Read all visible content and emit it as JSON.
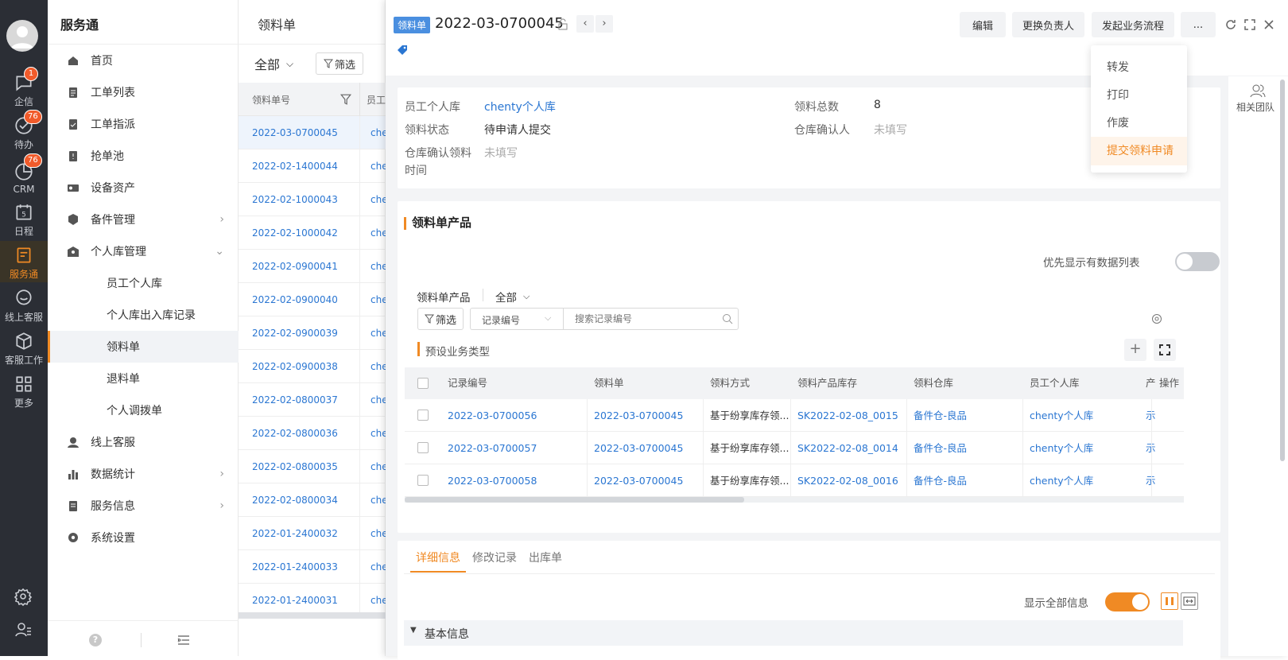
{
  "rail": {
    "items": [
      {
        "label": "企信",
        "badge": "1"
      },
      {
        "label": "待办",
        "badge": "76"
      },
      {
        "label": "CRM",
        "badge": "76"
      },
      {
        "label": "日程",
        "badge": ""
      },
      {
        "label": "服务通",
        "badge": ""
      },
      {
        "label": "线上客服",
        "badge": ""
      },
      {
        "label": "客服工作",
        "badge": ""
      },
      {
        "label": "更多",
        "badge": ""
      }
    ],
    "calendar_day": "5"
  },
  "menu": {
    "title": "服务通",
    "items": [
      {
        "label": "首页"
      },
      {
        "label": "工单列表"
      },
      {
        "label": "工单指派"
      },
      {
        "label": "抢单池"
      },
      {
        "label": "设备资产"
      },
      {
        "label": "备件管理"
      },
      {
        "label": "个人库管理"
      },
      {
        "label": "员工个人库"
      },
      {
        "label": "个人库出入库记录"
      },
      {
        "label": "领料单"
      },
      {
        "label": "退料单"
      },
      {
        "label": "个人调拨单"
      },
      {
        "label": "线上客服"
      },
      {
        "label": "数据统计"
      },
      {
        "label": "服务信息"
      },
      {
        "label": "系统设置"
      }
    ]
  },
  "list": {
    "title": "领料单",
    "scope": "全部",
    "filter": "筛选",
    "col_header": "领料单号",
    "col2_header": "员工",
    "row_suffix": "che",
    "rows": [
      "2022-03-0700045",
      "2022-02-1400044",
      "2022-02-1000043",
      "2022-02-1000042",
      "2022-02-0900041",
      "2022-02-0900040",
      "2022-02-0900039",
      "2022-02-0900038",
      "2022-02-0800037",
      "2022-02-0800036",
      "2022-02-0800035",
      "2022-02-0800034",
      "2022-01-2400032",
      "2022-01-2400033",
      "2022-01-2400031"
    ]
  },
  "detail": {
    "tag": "领料单",
    "number": "2022-03-0700045",
    "buttons": {
      "edit": "编辑",
      "change_owner": "更换负责人",
      "start_flow": "发起业务流程",
      "more": "..."
    },
    "dropdown": [
      "转发",
      "打印",
      "作废",
      "提交领料申请"
    ],
    "side_team": "相关团队",
    "fields": {
      "warehouse_label": "员工个人库",
      "warehouse_value": "chenty个人库",
      "total_label": "领料总数",
      "total_value": "8",
      "status_label": "领料状态",
      "status_value": "待申请人提交",
      "confirmer_label": "仓库确认人",
      "confirmer_value": "未填写",
      "confirm_time_label_1": "仓库确认领料",
      "confirm_time_label_2": "时间",
      "confirm_time_value": "未填写"
    },
    "products": {
      "title": "领料单产品",
      "toggle_label": "优先显示有数据列表",
      "sub_title": "领料单产品",
      "scope": "全部",
      "filter": "筛选",
      "search_field": "记录编号",
      "search_placeholder": "搜索记录编号",
      "preset_label": "预设业务类型",
      "columns": [
        "记录编号",
        "领料单",
        "领料方式",
        "领料产品库存",
        "领料仓库",
        "员工个人库",
        "产",
        "操作"
      ],
      "rows": [
        [
          "2022-03-0700056",
          "2022-03-0700045",
          "基于纷享库存领...",
          "SK2022-02-08_0015",
          "备件仓-良品",
          "chenty个人库",
          "示"
        ],
        [
          "2022-03-0700057",
          "2022-03-0700045",
          "基于纷享库存领...",
          "SK2022-02-08_0014",
          "备件仓-良品",
          "chenty个人库",
          "示"
        ],
        [
          "2022-03-0700058",
          "2022-03-0700045",
          "基于纷享库存领...",
          "SK2022-02-08_0016",
          "备件仓-良品",
          "chenty个人库",
          "示"
        ]
      ]
    },
    "tabs": [
      "详细信息",
      "修改记录",
      "出库单"
    ],
    "show_all_label": "显示全部信息",
    "section_basic": "基本信息"
  },
  "colors": {
    "accent": "#f08a24",
    "link": "#2a76d2",
    "rail_bg": "#2b2e35",
    "tag_bg": "#4a8fe0"
  }
}
